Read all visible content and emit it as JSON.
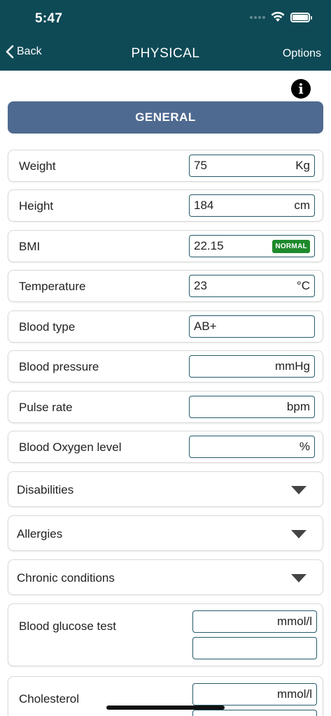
{
  "status": {
    "time": "5:47"
  },
  "nav": {
    "back_label": "Back",
    "title": "PHYSICAL",
    "options_label": "Options"
  },
  "info_icon": "i",
  "section": {
    "title": "GENERAL"
  },
  "fields": [
    {
      "label": "Weight",
      "value": "75",
      "unit": "Kg"
    },
    {
      "label": "Height",
      "value": "184",
      "unit": "cm"
    },
    {
      "label": "BMI",
      "value": "22.15",
      "badge": "NORMAL"
    },
    {
      "label": "Temperature",
      "value": "23",
      "unit": "°C"
    },
    {
      "label": "Blood type",
      "value": "AB+",
      "unit": ""
    },
    {
      "label": "Blood pressure",
      "value": "",
      "unit": "mmHg"
    },
    {
      "label": "Pulse rate",
      "value": "",
      "unit": "bpm"
    },
    {
      "label": "Blood Oxygen level",
      "value": "",
      "unit": "%"
    }
  ],
  "dropdowns": [
    {
      "label": "Disabilities"
    },
    {
      "label": "Allergies"
    },
    {
      "label": "Chronic conditions"
    }
  ],
  "glucose": {
    "label": "Blood glucose test",
    "unit": "mmol/l",
    "second_value": ""
  },
  "cholesterol": {
    "label": "Cholesterol",
    "unit": "mmol/l"
  },
  "colors": {
    "header_bg": "#0e4a56",
    "section_bg": "#4f6a90",
    "field_border": "#235a6a",
    "badge_bg": "#1e8a2c"
  },
  "icons": {
    "back": "chevron-left-icon",
    "info": "info-icon",
    "dropdown": "chevron-down-icon"
  }
}
